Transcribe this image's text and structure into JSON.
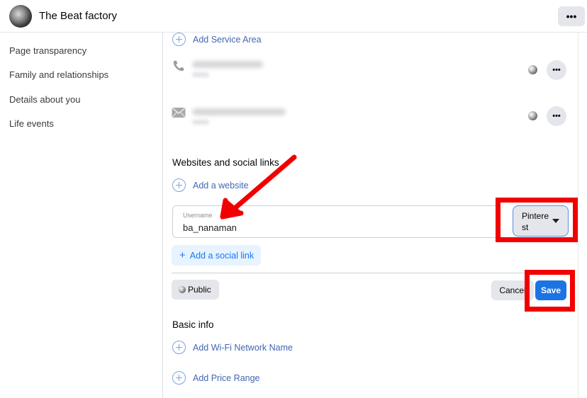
{
  "header": {
    "page_name": "The Beat factory",
    "more_icon": "more-horizontal-icon",
    "more_glyph": "•••"
  },
  "sidebar": {
    "items": [
      {
        "label": "Page transparency"
      },
      {
        "label": "Family and relationships"
      },
      {
        "label": "Details about you"
      },
      {
        "label": "Life events"
      }
    ]
  },
  "main": {
    "add_service_area": "Add Service Area",
    "contacts": [
      {
        "icon": "phone-icon",
        "value": "[blurred phone number]",
        "sublabel": "[blurred]",
        "privacy_icon": "globe-icon",
        "more_glyph": "•••"
      },
      {
        "icon": "envelope-icon",
        "value": "[blurred email]",
        "sublabel": "[blurred]",
        "privacy_icon": "globe-icon",
        "more_glyph": "•••"
      }
    ],
    "websites_section": {
      "title": "Websites and social links",
      "add_website": "Add a website",
      "username_field": {
        "label": "Username",
        "value": "ba_nanaman"
      },
      "network_select": {
        "selected": "Pinterest",
        "icon": "caret-down-icon"
      },
      "add_social_link": "Add a social link",
      "add_social_plus": "+",
      "privacy_button": "Public",
      "cancel": "Cancel",
      "save": "Save"
    },
    "basic_info": {
      "title": "Basic info",
      "add_wifi": "Add Wi-Fi Network Name",
      "add_price_range": "Add Price Range"
    }
  },
  "annotations": {
    "arrow_color": "#f20000",
    "highlight_color": "#f20000",
    "highlighted": [
      "network-select",
      "save-button"
    ]
  },
  "colors": {
    "link_blue": "#4267b2",
    "primary_blue": "#1b74e4",
    "button_gray": "#e4e6eb",
    "light_blue_bg": "#e7f3ff"
  }
}
